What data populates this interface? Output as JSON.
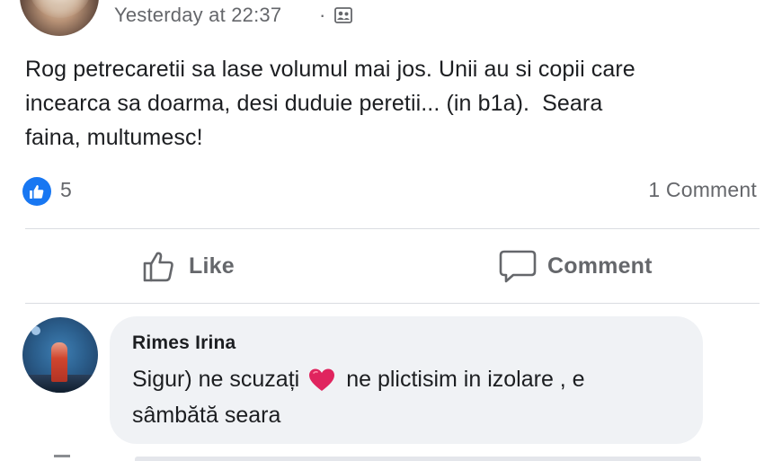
{
  "post": {
    "timestamp": "Yesterday at 22:37",
    "separator": "·",
    "audience_icon": "friends-audience-icon",
    "text": "Rog petrecaretii sa lase volumul mai jos. Unii au si copii care\nincearca sa doarma, desi duduie peretii... (in b1a).  Seara\nfaina, multumesc!"
  },
  "reactions": {
    "icon": "like-reaction-icon",
    "count": "5",
    "comments_count": "1 Comment"
  },
  "actions": {
    "like_label": "Like",
    "comment_label": "Comment"
  },
  "comment": {
    "author": "Rimes Irina",
    "text_before_emoji": "Sigur) ne scuzați",
    "emoji": "red-heart-emoji",
    "text_after_emoji": "ne plictisim in izolare , e",
    "text_line2": "sâmbătă seara"
  },
  "colors": {
    "accent": "#1877f2",
    "secondary_text": "#65676b",
    "bubble_bg": "#f0f2f5",
    "heart": "#e0245e"
  }
}
